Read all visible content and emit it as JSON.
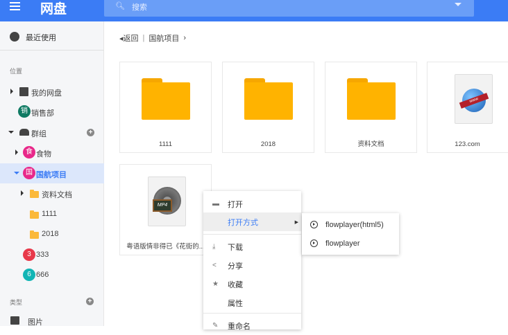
{
  "header": {
    "title": "网盘",
    "search_placeholder": "搜索"
  },
  "sidebar": {
    "recent": "最近使用",
    "section_location": "位置",
    "my_drive": "我的网盘",
    "sales": {
      "badge": "销",
      "label": "销售部"
    },
    "groups": "群组",
    "food": {
      "badge": "食",
      "label": "食物"
    },
    "project": {
      "badge": "国",
      "label": "国航项目"
    },
    "folders": [
      "资料文档",
      "1111",
      "2018"
    ],
    "g333": {
      "badge": "3",
      "label": "333"
    },
    "g666": {
      "badge": "6",
      "label": "666"
    },
    "section_type": "类型",
    "images": "图片"
  },
  "breadcrumb": {
    "back": "返回",
    "separator": "|",
    "current": "国航项目",
    "chevron": "›"
  },
  "files": [
    {
      "name": "1111",
      "type": "folder"
    },
    {
      "name": "2018",
      "type": "folder"
    },
    {
      "name": "资料文档",
      "type": "folder"
    },
    {
      "name": "123.com",
      "type": "web"
    },
    {
      "name": "粤语版情非得已《花街的...",
      "type": "mp4"
    }
  ],
  "context_menu": {
    "items": [
      "打开",
      "打开方式",
      "下载",
      "分享",
      "收藏",
      "属性",
      "重命名"
    ]
  },
  "submenu": {
    "items": [
      "flowplayer(html5)",
      "flowplayer"
    ]
  },
  "colors": {
    "accent": "#3b7cf5",
    "folder": "#ffb300",
    "sales": "#0f7a63",
    "food": "#e8288a",
    "g333": "#e8394a",
    "g666": "#12b5b5"
  }
}
